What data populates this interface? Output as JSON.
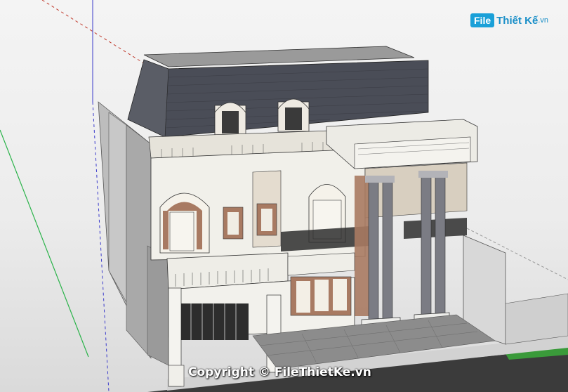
{
  "watermark": {
    "logo_mark": "File",
    "logo_text": "Thiết Kế",
    "logo_suffix": ".vn",
    "copyright": "Copyright © FileThietKe.vn"
  },
  "colors": {
    "axis_green": "#2bb34a",
    "axis_red": "#d83a2a",
    "axis_blue": "#3a3acb",
    "roof": "#4a4d57",
    "wall": "#f1f0ea",
    "wall_shadow": "#a5a5a5",
    "window_wood": "#a87a62",
    "grass": "#3a9a3a",
    "road": "#3b3b3b"
  }
}
